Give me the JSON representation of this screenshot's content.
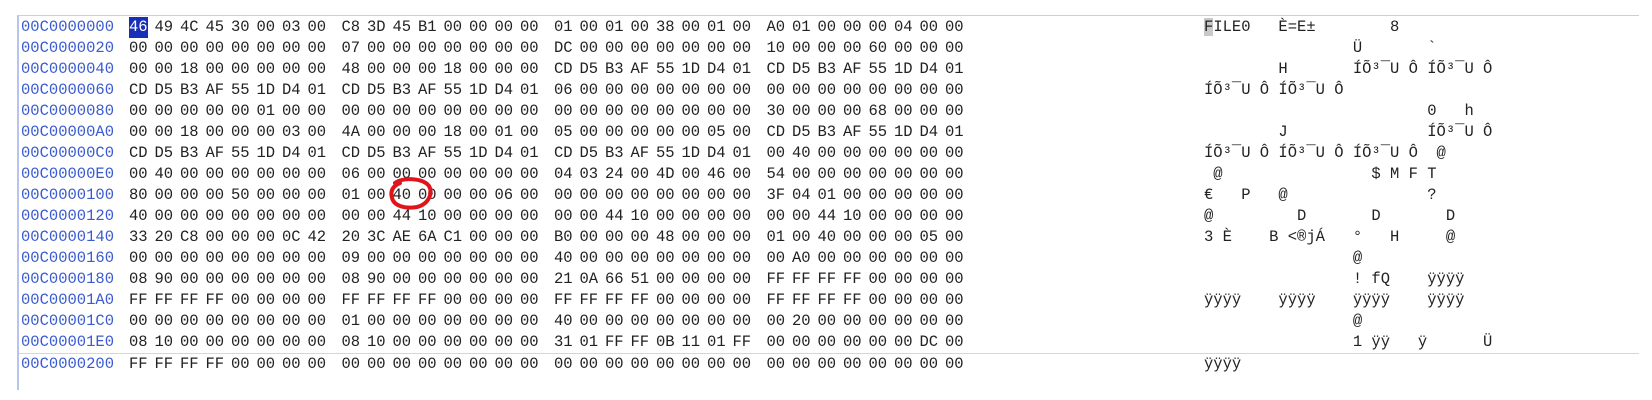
{
  "hex_view": {
    "rows": [
      {
        "offset": "00C0000000",
        "bytes": [
          "46",
          "49",
          "4C",
          "45",
          "30",
          "00",
          "03",
          "00",
          "C8",
          "3D",
          "45",
          "B1",
          "00",
          "00",
          "00",
          "00",
          "01",
          "00",
          "01",
          "00",
          "38",
          "00",
          "01",
          "00",
          "A0",
          "01",
          "00",
          "00",
          "00",
          "04",
          "00",
          "00"
        ],
        "ascii": "FILE0   È=E±        8            "
      },
      {
        "offset": "00C0000020",
        "bytes": [
          "00",
          "00",
          "00",
          "00",
          "00",
          "00",
          "00",
          "00",
          "07",
          "00",
          "00",
          "00",
          "00",
          "00",
          "00",
          "00",
          "DC",
          "00",
          "00",
          "00",
          "00",
          "00",
          "00",
          "00",
          "10",
          "00",
          "00",
          "00",
          "60",
          "00",
          "00",
          "00"
        ],
        "ascii": "                Ü       `   "
      },
      {
        "offset": "00C0000040",
        "bytes": [
          "00",
          "00",
          "18",
          "00",
          "00",
          "00",
          "00",
          "00",
          "48",
          "00",
          "00",
          "00",
          "18",
          "00",
          "00",
          "00",
          "CD",
          "D5",
          "B3",
          "AF",
          "55",
          "1D",
          "D4",
          "01",
          "CD",
          "D5",
          "B3",
          "AF",
          "55",
          "1D",
          "D4",
          "01"
        ],
        "ascii": "        H       ÍÕ³¯U Ô ÍÕ³¯U Ô "
      },
      {
        "offset": "00C0000060",
        "bytes": [
          "CD",
          "D5",
          "B3",
          "AF",
          "55",
          "1D",
          "D4",
          "01",
          "CD",
          "D5",
          "B3",
          "AF",
          "55",
          "1D",
          "D4",
          "01",
          "06",
          "00",
          "00",
          "00",
          "00",
          "00",
          "00",
          "00",
          "00",
          "00",
          "00",
          "00",
          "00",
          "00",
          "00",
          "00"
        ],
        "ascii": "ÍÕ³¯U Ô ÍÕ³¯U Ô "
      },
      {
        "offset": "00C0000080",
        "bytes": [
          "00",
          "00",
          "00",
          "00",
          "00",
          "01",
          "00",
          "00",
          "00",
          "00",
          "00",
          "00",
          "00",
          "00",
          "00",
          "00",
          "00",
          "00",
          "00",
          "00",
          "00",
          "00",
          "00",
          "00",
          "30",
          "00",
          "00",
          "00",
          "68",
          "00",
          "00",
          "00"
        ],
        "ascii": "                        0   h   "
      },
      {
        "offset": "00C00000A0",
        "bytes": [
          "00",
          "00",
          "18",
          "00",
          "00",
          "00",
          "03",
          "00",
          "4A",
          "00",
          "00",
          "00",
          "18",
          "00",
          "01",
          "00",
          "05",
          "00",
          "00",
          "00",
          "00",
          "00",
          "05",
          "00",
          "CD",
          "D5",
          "B3",
          "AF",
          "55",
          "1D",
          "D4",
          "01"
        ],
        "ascii": "        J               ÍÕ³¯U Ô "
      },
      {
        "offset": "00C00000C0",
        "bytes": [
          "CD",
          "D5",
          "B3",
          "AF",
          "55",
          "1D",
          "D4",
          "01",
          "CD",
          "D5",
          "B3",
          "AF",
          "55",
          "1D",
          "D4",
          "01",
          "CD",
          "D5",
          "B3",
          "AF",
          "55",
          "1D",
          "D4",
          "01",
          "00",
          "40",
          "00",
          "00",
          "00",
          "00",
          "00",
          "00"
        ],
        "ascii": "ÍÕ³¯U Ô ÍÕ³¯U Ô ÍÕ³¯U Ô  @      "
      },
      {
        "offset": "00C00000E0",
        "bytes": [
          "00",
          "40",
          "00",
          "00",
          "00",
          "00",
          "00",
          "00",
          "06",
          "00",
          "00",
          "00",
          "00",
          "00",
          "00",
          "00",
          "04",
          "03",
          "24",
          "00",
          "4D",
          "00",
          "46",
          "00",
          "54",
          "00",
          "00",
          "00",
          "00",
          "00",
          "00",
          "00"
        ],
        "ascii": " @                $ M F T       "
      },
      {
        "offset": "00C0000100",
        "bytes": [
          "80",
          "00",
          "00",
          "00",
          "50",
          "00",
          "00",
          "00",
          "01",
          "00",
          "40",
          "00",
          "00",
          "00",
          "06",
          "00",
          "00",
          "00",
          "00",
          "00",
          "00",
          "00",
          "00",
          "00",
          "3F",
          "04",
          "01",
          "00",
          "00",
          "00",
          "00",
          "00"
        ],
        "ascii": "€   P   @               ?       "
      },
      {
        "offset": "00C0000120",
        "bytes": [
          "40",
          "00",
          "00",
          "00",
          "00",
          "00",
          "00",
          "00",
          "00",
          "00",
          "44",
          "10",
          "00",
          "00",
          "00",
          "00",
          "00",
          "00",
          "44",
          "10",
          "00",
          "00",
          "00",
          "00",
          "00",
          "00",
          "44",
          "10",
          "00",
          "00",
          "00",
          "00"
        ],
        "ascii": "@         D       D       D     "
      },
      {
        "offset": "00C0000140",
        "bytes": [
          "33",
          "20",
          "C8",
          "00",
          "00",
          "00",
          "0C",
          "42",
          "20",
          "3C",
          "AE",
          "6A",
          "C1",
          "00",
          "00",
          "00",
          "B0",
          "00",
          "00",
          "00",
          "48",
          "00",
          "00",
          "00",
          "01",
          "00",
          "40",
          "00",
          "00",
          "00",
          "05",
          "00"
        ],
        "ascii": "3 È    B <®jÁ   °   H     @     "
      },
      {
        "offset": "00C0000160",
        "bytes": [
          "00",
          "00",
          "00",
          "00",
          "00",
          "00",
          "00",
          "00",
          "09",
          "00",
          "00",
          "00",
          "00",
          "00",
          "00",
          "00",
          "40",
          "00",
          "00",
          "00",
          "00",
          "00",
          "00",
          "00",
          "00",
          "A0",
          "00",
          "00",
          "00",
          "00",
          "00",
          "00"
        ],
        "ascii": "                @               "
      },
      {
        "offset": "00C0000180",
        "bytes": [
          "08",
          "90",
          "00",
          "00",
          "00",
          "00",
          "00",
          "00",
          "08",
          "90",
          "00",
          "00",
          "00",
          "00",
          "00",
          "00",
          "21",
          "0A",
          "66",
          "51",
          "00",
          "00",
          "00",
          "00",
          "FF",
          "FF",
          "FF",
          "FF",
          "00",
          "00",
          "00",
          "00"
        ],
        "ascii": "                ! fQ    ÿÿÿÿ    "
      },
      {
        "offset": "00C00001A0",
        "bytes": [
          "FF",
          "FF",
          "FF",
          "FF",
          "00",
          "00",
          "00",
          "00",
          "FF",
          "FF",
          "FF",
          "FF",
          "00",
          "00",
          "00",
          "00",
          "FF",
          "FF",
          "FF",
          "FF",
          "00",
          "00",
          "00",
          "00",
          "FF",
          "FF",
          "FF",
          "FF",
          "00",
          "00",
          "00",
          "00"
        ],
        "ascii": "ÿÿÿÿ    ÿÿÿÿ    ÿÿÿÿ    ÿÿÿÿ    "
      },
      {
        "offset": "00C00001C0",
        "bytes": [
          "00",
          "00",
          "00",
          "00",
          "00",
          "00",
          "00",
          "00",
          "01",
          "00",
          "00",
          "00",
          "00",
          "00",
          "00",
          "00",
          "40",
          "00",
          "00",
          "00",
          "00",
          "00",
          "00",
          "00",
          "00",
          "20",
          "00",
          "00",
          "00",
          "00",
          "00",
          "00"
        ],
        "ascii": "                @               "
      },
      {
        "offset": "00C00001E0",
        "bytes": [
          "08",
          "10",
          "00",
          "00",
          "00",
          "00",
          "00",
          "00",
          "08",
          "10",
          "00",
          "00",
          "00",
          "00",
          "00",
          "00",
          "31",
          "01",
          "FF",
          "FF",
          "0B",
          "11",
          "01",
          "FF",
          "00",
          "00",
          "00",
          "00",
          "00",
          "00",
          "DC",
          "00"
        ],
        "ascii": "                1 ÿÿ   ÿ      Ü "
      },
      {
        "offset": "00C0000200",
        "bytes": [
          "FF",
          "FF",
          "FF",
          "FF",
          "00",
          "00",
          "00",
          "00",
          "00",
          "00",
          "00",
          "00",
          "00",
          "00",
          "00",
          "00",
          "00",
          "00",
          "00",
          "00",
          "00",
          "00",
          "00",
          "00",
          "00",
          "00",
          "00",
          "00",
          "00",
          "00",
          "00",
          "00"
        ],
        "ascii": "ÿÿÿÿ"
      }
    ]
  },
  "colors": {
    "offset_text": "#3a5bd0",
    "cursor_bg": "#1a2fb8",
    "annotation": "#e0141b"
  }
}
